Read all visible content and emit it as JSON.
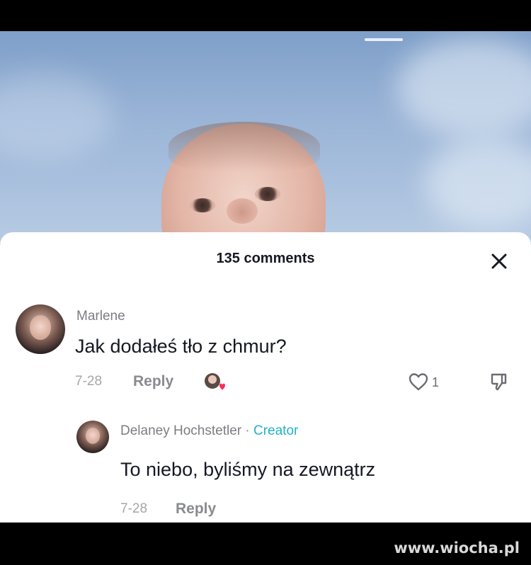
{
  "sheet": {
    "title": "135 comments"
  },
  "comments": [
    {
      "username": "Marlene",
      "text": "Jak dodałeś tło z chmur?",
      "date": "7-28",
      "reply_label": "Reply",
      "like_count": "1"
    }
  ],
  "reply": {
    "username": "Delaney Hochstetler",
    "separator": "·",
    "badge": "Creator",
    "text": "To niebo, byliśmy na zewnątrz",
    "date": "7-28",
    "reply_label": "Reply"
  },
  "watermark": "www.wiocha.pl",
  "icons": {
    "close": "close-icon",
    "like": "heart-icon",
    "dislike": "thumbs-down-icon",
    "creator_liked": "creator-liked-avatar-icon"
  },
  "colors": {
    "creator_badge": "#20b2c8",
    "creator_heart": "#fe2c55",
    "sheet_background": "#ffffff"
  }
}
